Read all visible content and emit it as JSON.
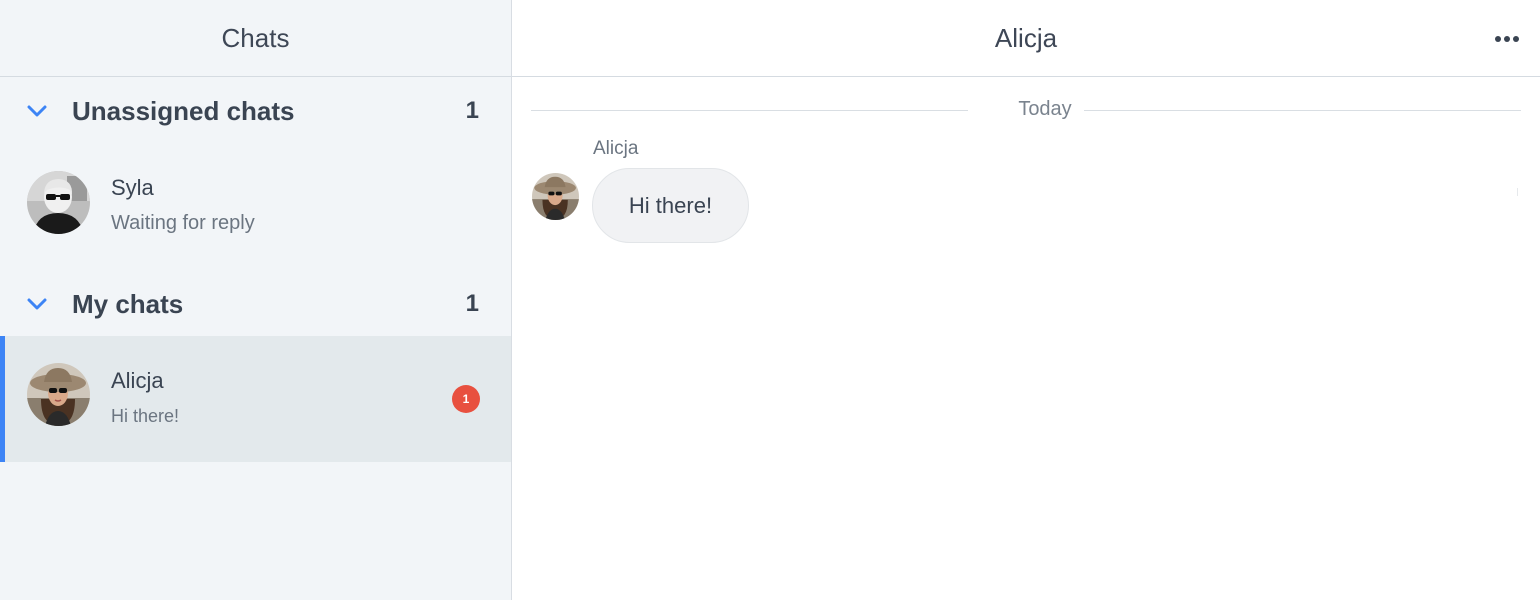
{
  "sidebar": {
    "title": "Chats",
    "sections": [
      {
        "title": "Unassigned chats",
        "count": "1",
        "chats": [
          {
            "name": "Syla",
            "preview": "Waiting for reply"
          }
        ]
      },
      {
        "title": "My chats",
        "count": "1",
        "chats": [
          {
            "name": "Alicja",
            "preview": "Hi there!",
            "unread": "1"
          }
        ]
      }
    ]
  },
  "conversation": {
    "title": "Alicja",
    "more_icon": "more-horizontal-icon",
    "divider_label": "Today",
    "messages": [
      {
        "author": "Alicja",
        "text": "Hi there!"
      }
    ]
  },
  "colors": {
    "accent": "#3d84f5",
    "badge": "#e8503f",
    "sidebar_bg": "#f2f5f8",
    "active_bg": "#e3e9ec",
    "bubble_bg": "#f1f2f4"
  }
}
